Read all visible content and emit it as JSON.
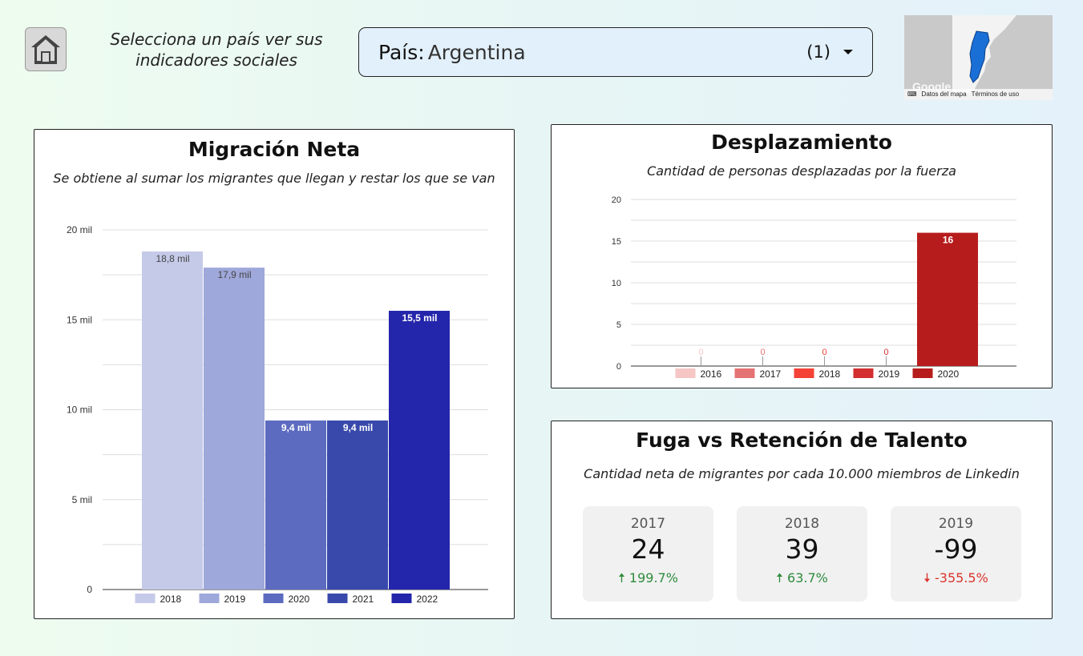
{
  "header": {
    "instruction": "Selecciona un país ver sus indicadores sociales",
    "select_label": "País",
    "select_value": "Argentina",
    "select_count": "(1)"
  },
  "map": {
    "logo": "Google",
    "map_data_link": "Datos del mapa",
    "terms_link": "Términos de uso",
    "highlight_color": "#1a6fd6"
  },
  "migracion": {
    "title": "Migración Neta",
    "subtitle": "Se obtiene al sumar los migrantes que llegan y restar los que se van"
  },
  "desplazamiento": {
    "title": "Desplazamiento",
    "subtitle": "Cantidad de personas desplazadas por la fuerza"
  },
  "fuga": {
    "title": "Fuga vs Retención de Talento",
    "subtitle": "Cantidad neta de migrantes por cada 10.000 miembros de Linkedin",
    "kpis": [
      {
        "year": "2017",
        "value": "24",
        "change": "199.7%",
        "direction": "up"
      },
      {
        "year": "2018",
        "value": "39",
        "change": "63.7%",
        "direction": "up"
      },
      {
        "year": "2019",
        "value": "-99",
        "change": "-355.5%",
        "direction": "down"
      }
    ]
  },
  "chart_data": [
    {
      "type": "bar",
      "categories": [
        "2018",
        "2019",
        "2020",
        "2021",
        "2022"
      ],
      "values": [
        18.8,
        17.9,
        9.4,
        9.4,
        15.5
      ],
      "data_labels": [
        "18,8 mil",
        "17,9 mil",
        "9,4 mil",
        "9,4 mil",
        "15,5 mil"
      ],
      "colors": [
        "#c5cae9",
        "#9fa8da",
        "#5c6bc0",
        "#3949ab",
        "#2325ab"
      ],
      "ylim": [
        0,
        20
      ],
      "yticks": [
        "0",
        "5 mil",
        "10 mil",
        "15 mil",
        "20 mil"
      ],
      "grid": true,
      "legend": "bottom"
    },
    {
      "type": "bar",
      "categories": [
        "2016",
        "2017",
        "2018",
        "2019",
        "2020"
      ],
      "values": [
        0,
        0,
        0,
        0,
        16
      ],
      "data_labels": [
        "0",
        "0",
        "0",
        "0",
        "16"
      ],
      "colors": [
        "#f5c6c4",
        "#e57373",
        "#f44336",
        "#d32f2f",
        "#b71c1c"
      ],
      "ylim": [
        0,
        20
      ],
      "yticks": [
        "0",
        "5",
        "10",
        "15",
        "20"
      ],
      "grid": true,
      "legend": "bottom"
    }
  ]
}
